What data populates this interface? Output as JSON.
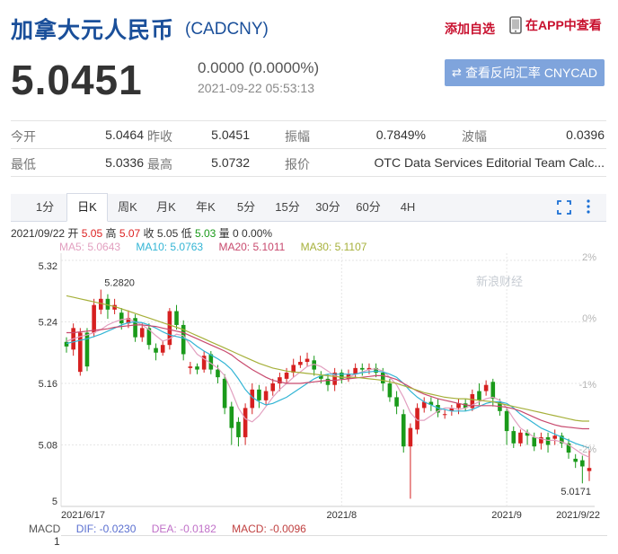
{
  "header": {
    "title": "加拿大元人民币",
    "code": "(CADCNY)",
    "add_watchlist": "添加自选",
    "app_view": "在APP中查看"
  },
  "quote": {
    "price": "5.0451",
    "change": "0.0000 (0.0000%)",
    "time": "2021-09-22 05:53:13",
    "reverse_label": "查看反向汇率 CNYCAD"
  },
  "stats": {
    "rows": [
      [
        {
          "label": "今开",
          "value": "5.0464"
        },
        {
          "label": "昨收",
          "value": "5.0451"
        },
        {
          "label": "振幅",
          "value": "0.7849%"
        },
        {
          "label": "波幅",
          "value": "0.0396"
        }
      ],
      [
        {
          "label": "最低",
          "value": "5.0336"
        },
        {
          "label": "最高",
          "value": "5.0732"
        },
        {
          "label": "报价",
          "value": "OTC Data Services Editorial Team Calc..."
        }
      ]
    ]
  },
  "tabs": [
    "1分",
    "日K",
    "周K",
    "月K",
    "年K",
    "5分",
    "15分",
    "30分",
    "60分",
    "4H"
  ],
  "active_tab": 1,
  "ohlc": {
    "date": "2021/09/22",
    "open_label": "开",
    "open": "5.05",
    "high_label": "高",
    "high": "5.07",
    "close_label": "收",
    "close": "5.05",
    "low_label": "低",
    "low": "5.03",
    "vol_label": "量",
    "vol": "0 0.00%"
  },
  "ma": [
    {
      "label": "MA5: 5.0643",
      "color": "#e2a0c0"
    },
    {
      "label": "MA10: 5.0763",
      "color": "#33b5d5"
    },
    {
      "label": "MA20: 5.1011",
      "color": "#c84a6e"
    },
    {
      "label": "MA30: 5.1107",
      "color": "#a6b03a"
    }
  ],
  "macd": {
    "title": "MACD",
    "dif": {
      "label": "DIF: -0.0230",
      "color": "#5a6fd0"
    },
    "dea": {
      "label": "DEA: -0.0182",
      "color": "#c070c8"
    },
    "macd": {
      "label": "MACD: -0.0096",
      "color": "#c04040"
    },
    "axis_first": "1"
  },
  "chart_data": {
    "type": "candlestick",
    "y_ticks": [
      "5.32",
      "5.24",
      "5.16",
      "5.08",
      "5"
    ],
    "ylim": [
      5.0,
      5.32
    ],
    "pct_ticks": [
      "2%",
      "0%",
      "-1%",
      "-2%"
    ],
    "x_ticks": [
      "2021/6/17",
      "2021/8",
      "2021/9",
      "2021/9/22"
    ],
    "annotations": {
      "max": "5.2820",
      "min": "5.0171"
    },
    "watermark": "新浪财经",
    "candles": [
      [
        5.214,
        5.208,
        5.22,
        5.2
      ],
      [
        5.204,
        5.232,
        5.238,
        5.196
      ],
      [
        5.175,
        5.226,
        5.232,
        5.17
      ],
      [
        5.226,
        5.182,
        5.232,
        5.176
      ],
      [
        5.226,
        5.262,
        5.27,
        5.22
      ],
      [
        5.256,
        5.27,
        5.282,
        5.25
      ],
      [
        5.27,
        5.256,
        5.276,
        5.244
      ],
      [
        5.256,
        5.262,
        5.27,
        5.25
      ],
      [
        5.252,
        5.238,
        5.258,
        5.23
      ],
      [
        5.238,
        5.245,
        5.255,
        5.232
      ],
      [
        5.245,
        5.22,
        5.25,
        5.214
      ],
      [
        5.22,
        5.232,
        5.238,
        5.214
      ],
      [
        5.232,
        5.21,
        5.238,
        5.204
      ],
      [
        5.206,
        5.2,
        5.212,
        5.19
      ],
      [
        5.2,
        5.21,
        5.216,
        5.196
      ],
      [
        5.21,
        5.254,
        5.258,
        5.204
      ],
      [
        5.254,
        5.236,
        5.262,
        5.23
      ],
      [
        5.236,
        5.198,
        5.242,
        5.19
      ],
      [
        5.18,
        5.182,
        5.188,
        5.172
      ],
      [
        5.182,
        5.178,
        5.186,
        5.172
      ],
      [
        5.178,
        5.196,
        5.202,
        5.174
      ],
      [
        5.198,
        5.178,
        5.202,
        5.172
      ],
      [
        5.178,
        5.168,
        5.184,
        5.16
      ],
      [
        5.166,
        5.128,
        5.172,
        5.12
      ],
      [
        5.13,
        5.102,
        5.136,
        5.08
      ],
      [
        5.11,
        5.09,
        5.116,
        5.078
      ],
      [
        5.09,
        5.128,
        5.134,
        5.08
      ],
      [
        5.128,
        5.152,
        5.16,
        5.12
      ],
      [
        5.152,
        5.138,
        5.158,
        5.128
      ],
      [
        5.138,
        5.15,
        5.156,
        5.132
      ],
      [
        5.15,
        5.16,
        5.166,
        5.144
      ],
      [
        5.16,
        5.168,
        5.174,
        5.15
      ],
      [
        5.166,
        5.174,
        5.18,
        5.16
      ],
      [
        5.174,
        5.184,
        5.192,
        5.168
      ],
      [
        5.184,
        5.188,
        5.196,
        5.18
      ],
      [
        5.188,
        5.192,
        5.2,
        5.182
      ],
      [
        5.19,
        5.178,
        5.196,
        5.17
      ],
      [
        5.17,
        5.166,
        5.176,
        5.16
      ],
      [
        5.166,
        5.158,
        5.172,
        5.15
      ],
      [
        5.158,
        5.174,
        5.18,
        5.15
      ],
      [
        5.174,
        5.166,
        5.178,
        5.16
      ],
      [
        5.166,
        5.172,
        5.178,
        5.162
      ],
      [
        5.172,
        5.18,
        5.186,
        5.168
      ],
      [
        5.18,
        5.178,
        5.186,
        5.17
      ],
      [
        5.178,
        5.18,
        5.186,
        5.172
      ],
      [
        5.18,
        5.174,
        5.186,
        5.168
      ],
      [
        5.174,
        5.16,
        5.18,
        5.15
      ],
      [
        5.16,
        5.142,
        5.166,
        5.136
      ],
      [
        5.142,
        5.13,
        5.15,
        5.12
      ],
      [
        5.12,
        5.078,
        5.126,
        5.07
      ],
      [
        5.078,
        5.102,
        5.108,
        5.01
      ],
      [
        5.1,
        5.128,
        5.134,
        5.094
      ],
      [
        5.128,
        5.136,
        5.142,
        5.122
      ],
      [
        5.136,
        5.132,
        5.142,
        5.124
      ],
      [
        5.132,
        5.122,
        5.14,
        5.116
      ],
      [
        5.12,
        5.12,
        5.126,
        5.114
      ],
      [
        5.124,
        5.128,
        5.132,
        5.118
      ],
      [
        5.128,
        5.134,
        5.14,
        5.12
      ],
      [
        5.134,
        5.128,
        5.14,
        5.124
      ],
      [
        5.128,
        5.146,
        5.152,
        5.124
      ],
      [
        5.15,
        5.138,
        5.16,
        5.132
      ],
      [
        5.15,
        5.158,
        5.164,
        5.144
      ],
      [
        5.162,
        5.14,
        5.166,
        5.13
      ],
      [
        5.136,
        5.124,
        5.14,
        5.118
      ],
      [
        5.124,
        5.098,
        5.128,
        5.08
      ],
      [
        5.098,
        5.082,
        5.104,
        5.076
      ],
      [
        5.082,
        5.096,
        5.1,
        5.078
      ],
      [
        5.096,
        5.092,
        5.1,
        5.08
      ],
      [
        5.09,
        5.078,
        5.096,
        5.072
      ],
      [
        5.082,
        5.09,
        5.096,
        5.074
      ],
      [
        5.09,
        5.08,
        5.096,
        5.07
      ],
      [
        5.088,
        5.092,
        5.1,
        5.08
      ],
      [
        5.092,
        5.082,
        5.096,
        5.076
      ],
      [
        5.082,
        5.07,
        5.088,
        5.062
      ],
      [
        5.062,
        5.058,
        5.068,
        5.05
      ],
      [
        5.06,
        5.052,
        5.066,
        5.03
      ],
      [
        5.046,
        5.05,
        5.073,
        5.033
      ]
    ],
    "series": [
      {
        "name": "MA5",
        "values": [
          5.215,
          5.218,
          5.221,
          5.223,
          5.226,
          5.23,
          5.236,
          5.24,
          5.243,
          5.244,
          5.24,
          5.236,
          5.23,
          5.222,
          5.215,
          5.218,
          5.224,
          5.222,
          5.21,
          5.198,
          5.192,
          5.186,
          5.18,
          5.17,
          5.15,
          5.128,
          5.114,
          5.11,
          5.118,
          5.13,
          5.142,
          5.152,
          5.16,
          5.168,
          5.175,
          5.182,
          5.185,
          5.182,
          5.176,
          5.17,
          5.168,
          5.168,
          5.172,
          5.175,
          5.178,
          5.179,
          5.176,
          5.168,
          5.158,
          5.142,
          5.122,
          5.112,
          5.112,
          5.118,
          5.124,
          5.128,
          5.128,
          5.126,
          5.128,
          5.132,
          5.136,
          5.14,
          5.142,
          5.138,
          5.128,
          5.114,
          5.102,
          5.096,
          5.09,
          5.088,
          5.086,
          5.086,
          5.084,
          5.08,
          5.074,
          5.068,
          5.064
        ]
      },
      {
        "name": "MA10",
        "values": [
          5.212,
          5.214,
          5.216,
          5.218,
          5.221,
          5.224,
          5.228,
          5.232,
          5.236,
          5.239,
          5.24,
          5.239,
          5.236,
          5.232,
          5.227,
          5.223,
          5.221,
          5.219,
          5.215,
          5.208,
          5.202,
          5.197,
          5.192,
          5.186,
          5.178,
          5.166,
          5.152,
          5.142,
          5.136,
          5.132,
          5.134,
          5.138,
          5.142,
          5.148,
          5.154,
          5.16,
          5.166,
          5.17,
          5.172,
          5.172,
          5.172,
          5.172,
          5.172,
          5.174,
          5.175,
          5.176,
          5.175,
          5.172,
          5.168,
          5.16,
          5.15,
          5.142,
          5.136,
          5.132,
          5.128,
          5.126,
          5.124,
          5.124,
          5.124,
          5.126,
          5.13,
          5.134,
          5.136,
          5.136,
          5.134,
          5.128,
          5.12,
          5.114,
          5.108,
          5.102,
          5.098,
          5.094,
          5.09,
          5.086,
          5.082,
          5.079,
          5.076
        ]
      },
      {
        "name": "MA20",
        "values": [
          5.226,
          5.226,
          5.227,
          5.228,
          5.229,
          5.23,
          5.231,
          5.233,
          5.234,
          5.235,
          5.236,
          5.236,
          5.235,
          5.234,
          5.232,
          5.23,
          5.228,
          5.226,
          5.222,
          5.218,
          5.214,
          5.21,
          5.206,
          5.202,
          5.197,
          5.19,
          5.184,
          5.178,
          5.173,
          5.168,
          5.164,
          5.162,
          5.16,
          5.16,
          5.16,
          5.161,
          5.162,
          5.163,
          5.164,
          5.164,
          5.165,
          5.166,
          5.167,
          5.168,
          5.169,
          5.17,
          5.17,
          5.168,
          5.165,
          5.16,
          5.155,
          5.15,
          5.146,
          5.143,
          5.14,
          5.138,
          5.136,
          5.134,
          5.132,
          5.131,
          5.131,
          5.131,
          5.131,
          5.13,
          5.129,
          5.127,
          5.124,
          5.12,
          5.116,
          5.112,
          5.109,
          5.106,
          5.104,
          5.103,
          5.102,
          5.101,
          5.101
        ]
      },
      {
        "name": "MA30",
        "values": [
          5.274,
          5.272,
          5.27,
          5.268,
          5.266,
          5.264,
          5.262,
          5.26,
          5.257,
          5.254,
          5.251,
          5.248,
          5.245,
          5.242,
          5.239,
          5.236,
          5.233,
          5.23,
          5.226,
          5.222,
          5.218,
          5.214,
          5.21,
          5.206,
          5.202,
          5.198,
          5.194,
          5.19,
          5.186,
          5.183,
          5.18,
          5.178,
          5.176,
          5.175,
          5.174,
          5.173,
          5.172,
          5.171,
          5.17,
          5.169,
          5.168,
          5.168,
          5.168,
          5.167,
          5.166,
          5.165,
          5.164,
          5.162,
          5.16,
          5.157,
          5.154,
          5.151,
          5.148,
          5.146,
          5.144,
          5.142,
          5.141,
          5.14,
          5.14,
          5.139,
          5.138,
          5.137,
          5.136,
          5.134,
          5.132,
          5.13,
          5.128,
          5.126,
          5.124,
          5.122,
          5.12,
          5.118,
          5.116,
          5.114,
          5.112,
          5.111,
          5.111
        ]
      }
    ]
  }
}
